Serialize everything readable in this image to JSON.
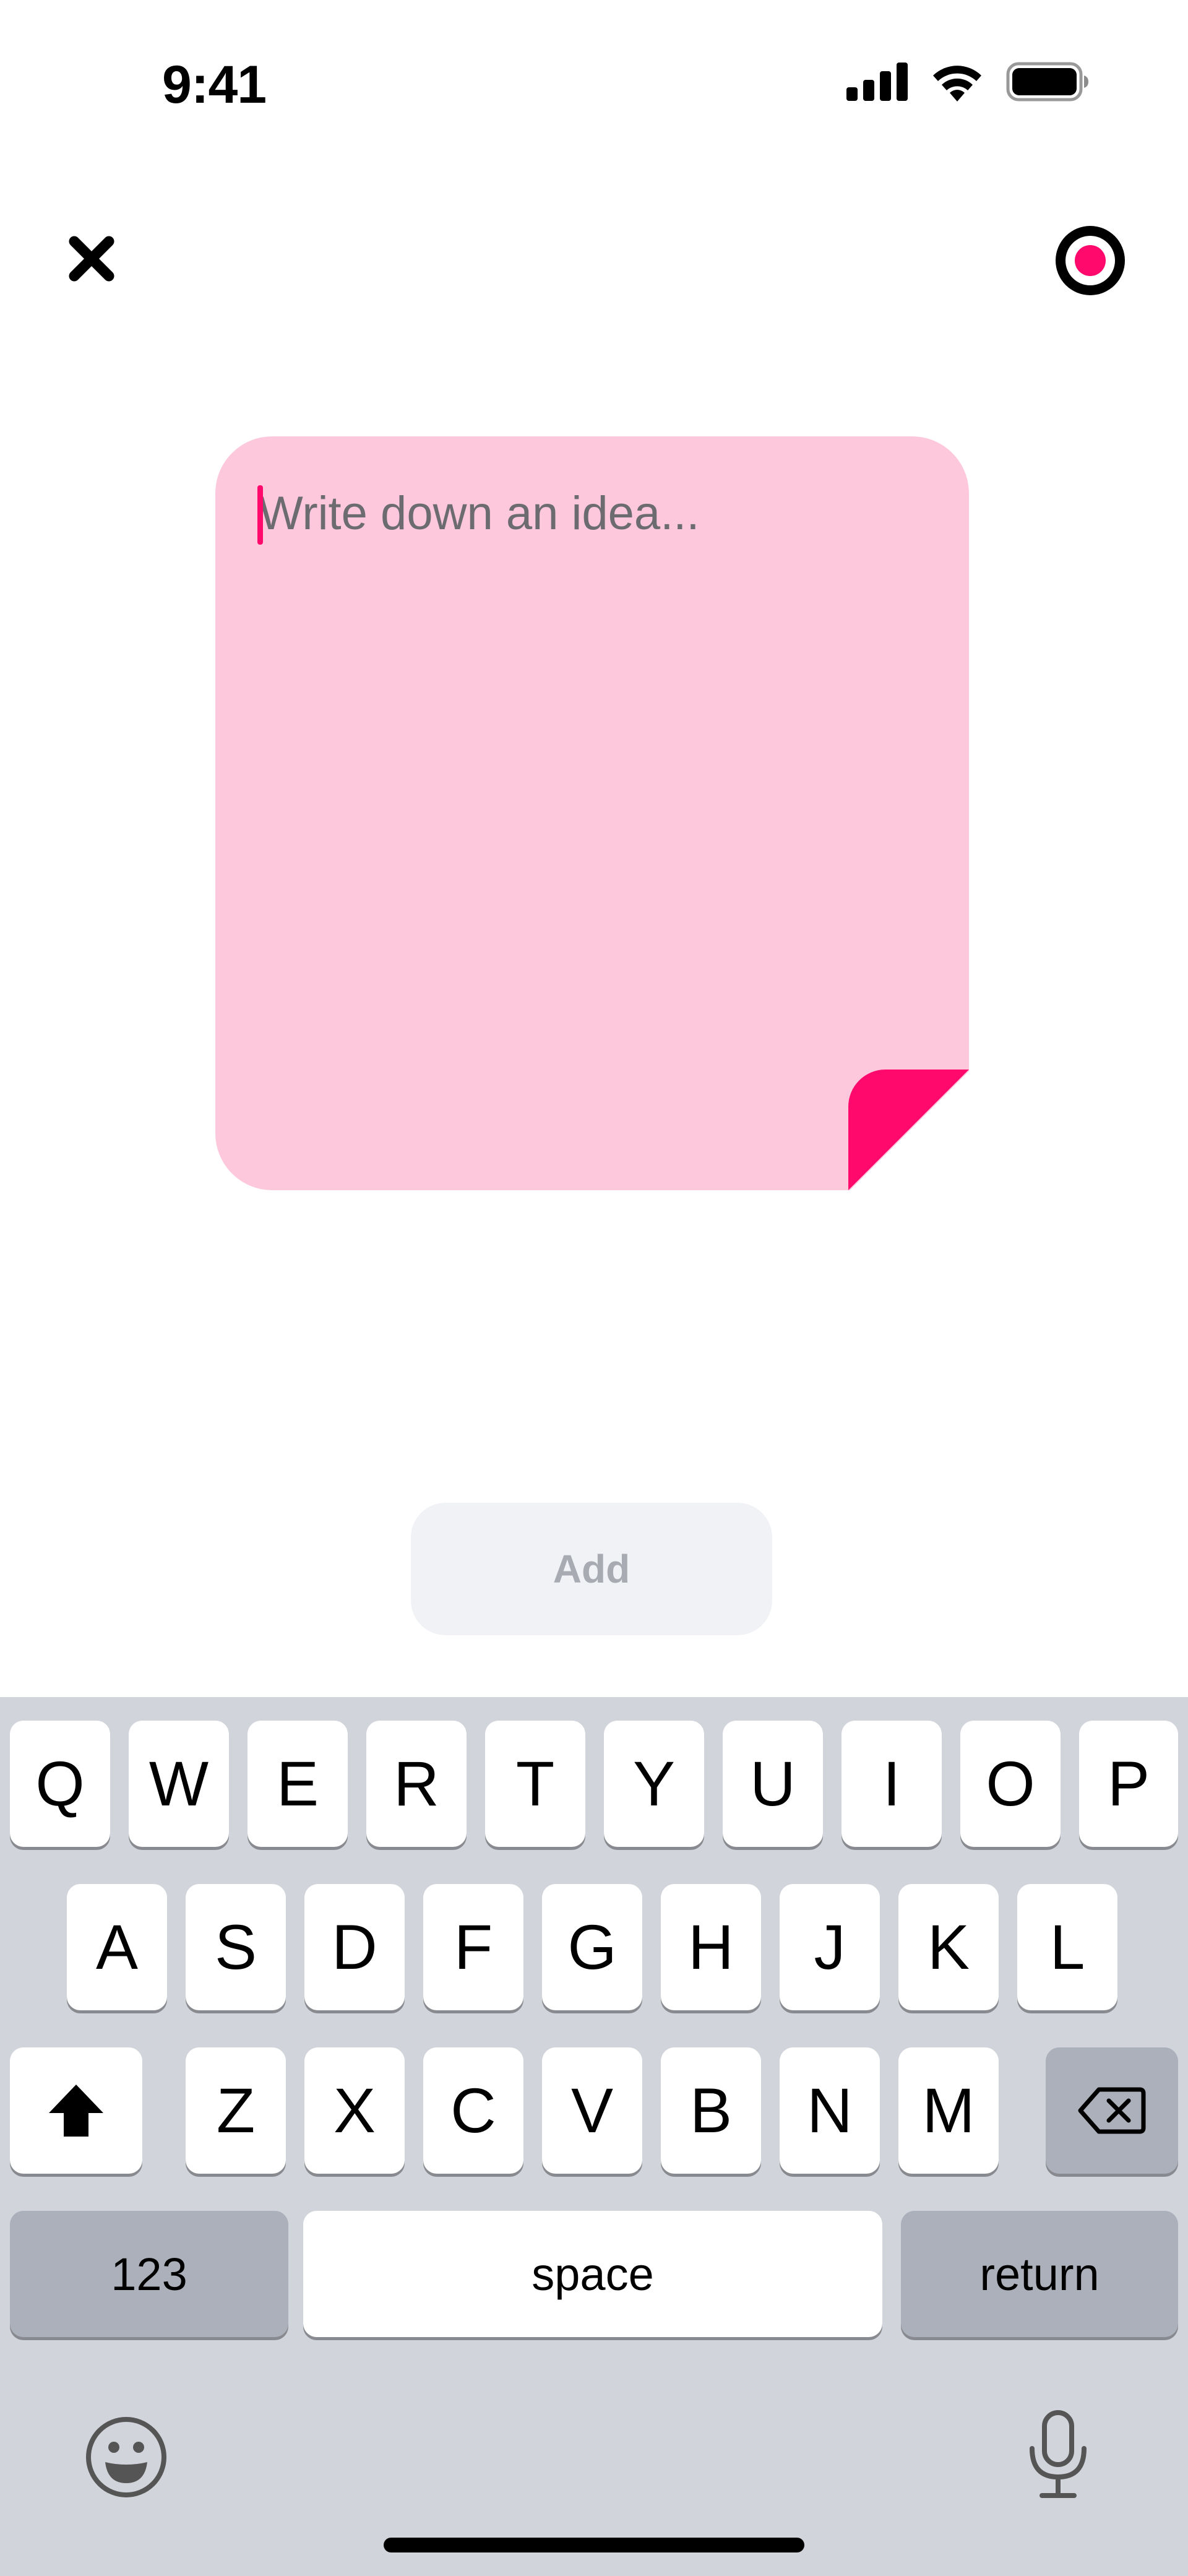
{
  "status_bar": {
    "time": "9:41",
    "icons": [
      "cellular-signal-icon",
      "wifi-icon",
      "battery-icon"
    ]
  },
  "header": {
    "close_icon": "close-icon",
    "record_icon": "record-icon"
  },
  "note": {
    "placeholder": "Write down an idea...",
    "value": "",
    "background_color": "#fdc8dc",
    "accent_color": "#ff0a6c"
  },
  "add_button": {
    "label": "Add",
    "enabled": false
  },
  "keyboard": {
    "row1": [
      "Q",
      "W",
      "E",
      "R",
      "T",
      "Y",
      "U",
      "I",
      "O",
      "P"
    ],
    "row2": [
      "A",
      "S",
      "D",
      "F",
      "G",
      "H",
      "J",
      "K",
      "L"
    ],
    "row3": [
      "Z",
      "X",
      "C",
      "V",
      "B",
      "N",
      "M"
    ],
    "shift_icon": "shift-icon",
    "delete_icon": "delete-backspace-icon",
    "numbers_label": "123",
    "space_label": "space",
    "return_label": "return",
    "emoji_icon": "emoji-icon",
    "mic_icon": "microphone-icon"
  }
}
